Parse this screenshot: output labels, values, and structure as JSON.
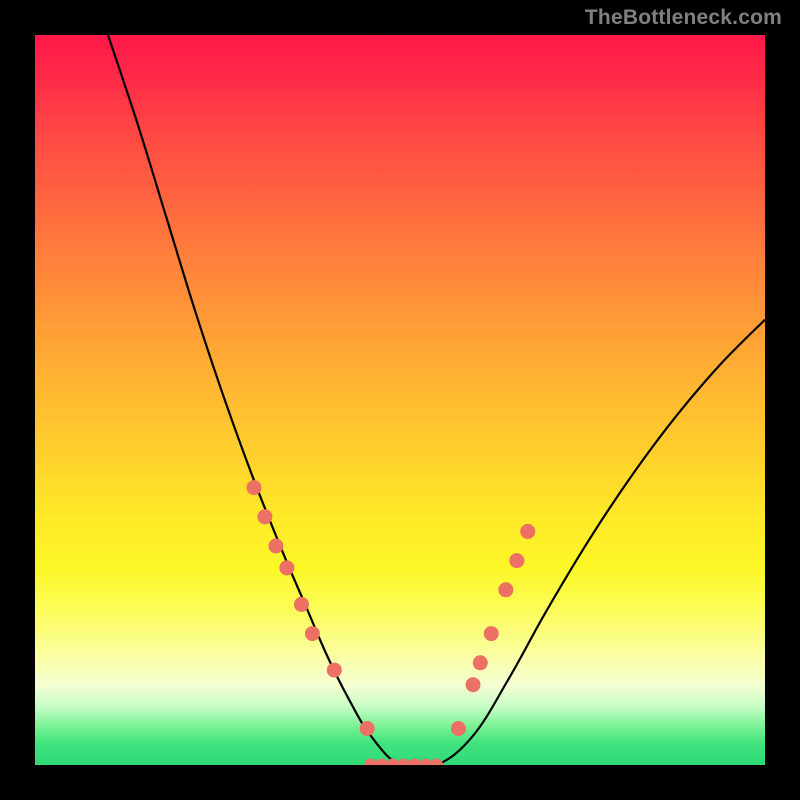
{
  "watermark": "TheBottleneck.com",
  "chart_data": {
    "type": "line",
    "title": "",
    "xlabel": "",
    "ylabel": "",
    "xlim": [
      0,
      100
    ],
    "ylim": [
      0,
      100
    ],
    "series": [
      {
        "name": "curve",
        "x": [
          10,
          14,
          18,
          22,
          26,
          30,
          34,
          37,
          40,
          43,
          46,
          50,
          55,
          60,
          65,
          70,
          76,
          82,
          88,
          94,
          100
        ],
        "values": [
          100,
          88,
          75,
          62,
          50,
          39,
          29,
          22,
          15,
          9,
          4,
          0,
          0,
          4,
          12,
          21,
          31,
          40,
          48,
          55,
          61
        ]
      }
    ],
    "markers": {
      "left_cluster": {
        "x": [
          30.0,
          31.5,
          33.0,
          34.5,
          36.5,
          38.0,
          41.0,
          45.5
        ],
        "y": [
          38,
          34,
          30,
          27,
          22,
          18,
          13,
          5
        ]
      },
      "right_cluster": {
        "x": [
          58.0,
          60.0,
          61.0,
          62.5,
          64.5,
          66.0,
          67.5
        ],
        "y": [
          5,
          11,
          14,
          18,
          24,
          28,
          32
        ]
      },
      "valley_floor": {
        "x": [
          46.0,
          47.5,
          49.0,
          50.5,
          52.0,
          53.5,
          55.0
        ],
        "y": [
          0,
          0,
          0,
          0,
          0,
          0,
          0
        ]
      }
    },
    "colors": {
      "curve": "#000000",
      "marker_fill": "#ec7063",
      "marker_stroke": "#ec7063",
      "gradient_top": "#ff1749",
      "gradient_bottom": "#2fd877",
      "frame": "#000000"
    }
  }
}
